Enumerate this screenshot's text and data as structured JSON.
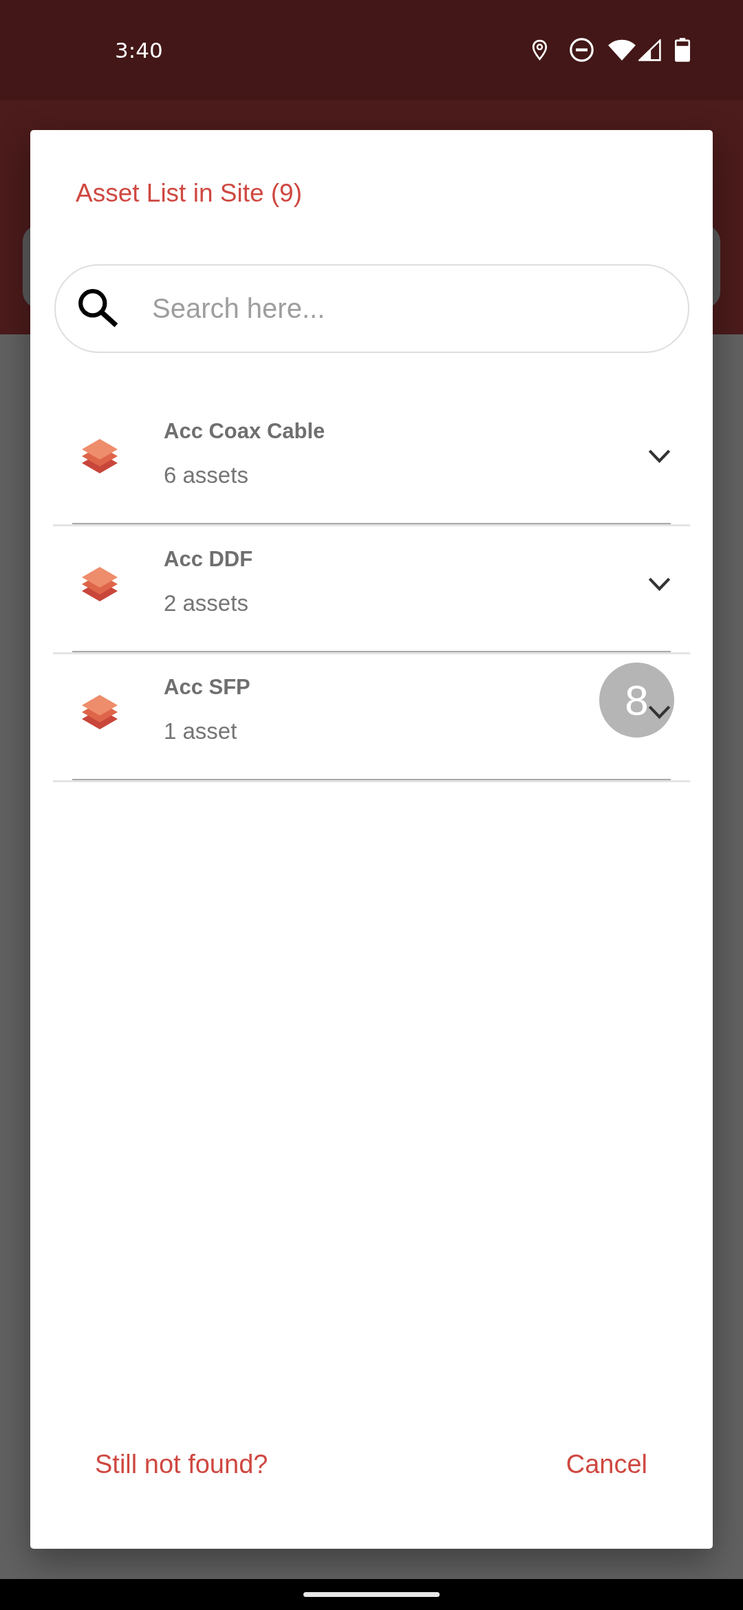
{
  "status_bar": {
    "time": "3:40"
  },
  "dialog": {
    "title": "Asset List in Site (9)",
    "search": {
      "placeholder": "Search here..."
    },
    "assets": [
      {
        "name": "Acc Coax Cable",
        "count": "6 assets",
        "expanded": false
      },
      {
        "name": "Acc DDF",
        "count": "2 assets",
        "expanded": false
      },
      {
        "name": "Acc SFP",
        "count": "1 asset",
        "expanded": false
      }
    ],
    "buttons": [
      "Still not found?",
      "Cancel"
    ]
  },
  "touch_badge": {
    "label": "8"
  }
}
